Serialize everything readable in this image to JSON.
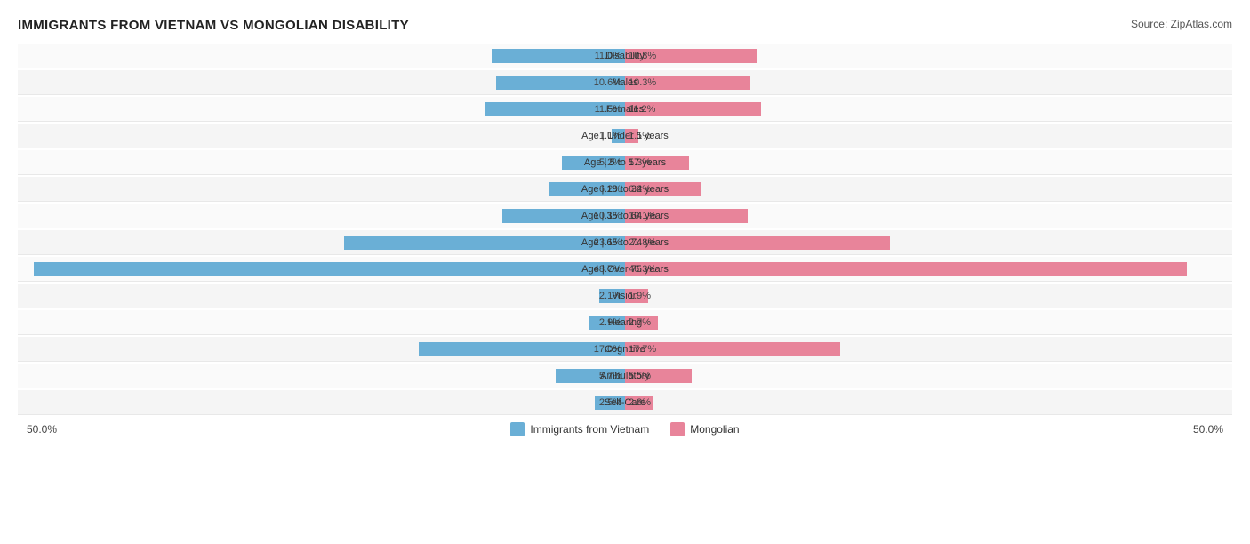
{
  "title": "IMMIGRANTS FROM VIETNAM VS MONGOLIAN DISABILITY",
  "source": "Source: ZipAtlas.com",
  "colors": {
    "blue": "#6aafd6",
    "pink": "#e8849a",
    "blue_dark": "#4a9bc4"
  },
  "legend": {
    "left_label": "Immigrants from Vietnam",
    "right_label": "Mongolian"
  },
  "axis": {
    "left": "50.0%",
    "right": "50.0%"
  },
  "rows": [
    {
      "label": "Disability",
      "left_val": "11.0%",
      "left_pct": 11.0,
      "right_val": "10.8%",
      "right_pct": 10.8
    },
    {
      "label": "Males",
      "left_val": "10.6%",
      "left_pct": 10.6,
      "right_val": "10.3%",
      "right_pct": 10.3
    },
    {
      "label": "Females",
      "left_val": "11.5%",
      "left_pct": 11.5,
      "right_val": "11.2%",
      "right_pct": 11.2
    },
    {
      "label": "Age | Under 5 years",
      "left_val": "1.1%",
      "left_pct": 1.1,
      "right_val": "1.1%",
      "right_pct": 1.1
    },
    {
      "label": "Age | 5 to 17 years",
      "left_val": "5.2%",
      "left_pct": 5.2,
      "right_val": "5.3%",
      "right_pct": 5.3
    },
    {
      "label": "Age | 18 to 34 years",
      "left_val": "6.2%",
      "left_pct": 6.2,
      "right_val": "6.2%",
      "right_pct": 6.2
    },
    {
      "label": "Age | 35 to 64 years",
      "left_val": "10.1%",
      "left_pct": 10.1,
      "right_val": "10.1%",
      "right_pct": 10.1
    },
    {
      "label": "Age | 65 to 74 years",
      "left_val": "23.1%",
      "left_pct": 23.1,
      "right_val": "21.8%",
      "right_pct": 21.8
    },
    {
      "label": "Age | Over 75 years",
      "left_val": "48.7%",
      "left_pct": 48.7,
      "right_val": "46.3%",
      "right_pct": 46.3
    },
    {
      "label": "Vision",
      "left_val": "2.1%",
      "left_pct": 2.1,
      "right_val": "1.9%",
      "right_pct": 1.9
    },
    {
      "label": "Hearing",
      "left_val": "2.9%",
      "left_pct": 2.9,
      "right_val": "2.7%",
      "right_pct": 2.7
    },
    {
      "label": "Cognitive",
      "left_val": "17.0%",
      "left_pct": 17.0,
      "right_val": "17.7%",
      "right_pct": 17.7
    },
    {
      "label": "Ambulatory",
      "left_val": "5.7%",
      "left_pct": 5.7,
      "right_val": "5.5%",
      "right_pct": 5.5
    },
    {
      "label": "Self-Care",
      "left_val": "2.5%",
      "left_pct": 2.5,
      "right_val": "2.3%",
      "right_pct": 2.3
    }
  ],
  "max_pct": 50
}
